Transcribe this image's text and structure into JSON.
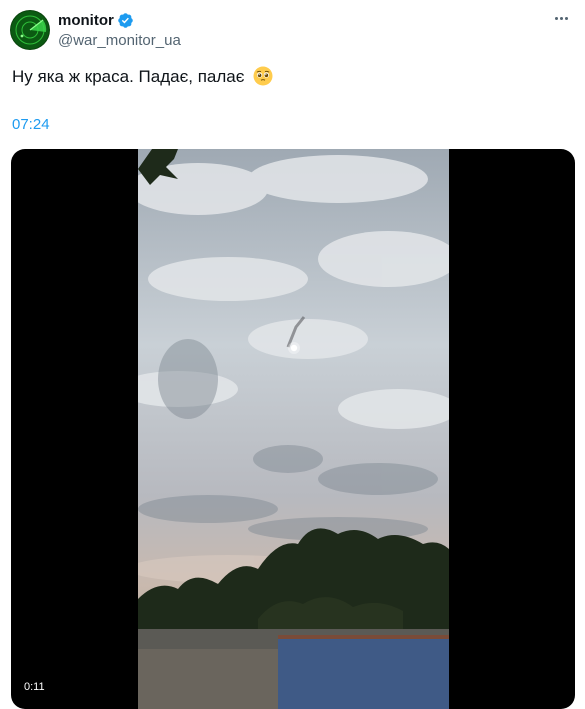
{
  "author": {
    "display_name": "monitor",
    "handle": "@war_monitor_ua",
    "verified": true,
    "avatar_icon": "radar-icon"
  },
  "tweet": {
    "text": "Ну яка ж краса. Падає, палає",
    "emoji": "pleading-face-emoji",
    "timestamp": "07:24"
  },
  "media": {
    "type": "video",
    "duration": "0:11"
  },
  "colors": {
    "link": "#1d9bf0",
    "secondary_text": "#536471",
    "primary_text": "#0f1419"
  }
}
